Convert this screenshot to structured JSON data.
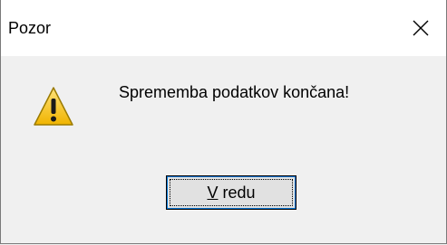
{
  "dialog": {
    "title": "Pozor",
    "close_icon": "close-icon",
    "warning_icon": "warning-icon",
    "message": "Sprememba podatkov končana!",
    "ok_button": {
      "mnemonic": "V",
      "rest": " redu"
    }
  },
  "colors": {
    "titlebar": "#ffffff",
    "body": "#f0f0f0",
    "button_face": "#e1e1e1",
    "button_focus": "#0078d7",
    "warning_fill": "#f4c430",
    "warning_outline": "#8a6d00"
  }
}
